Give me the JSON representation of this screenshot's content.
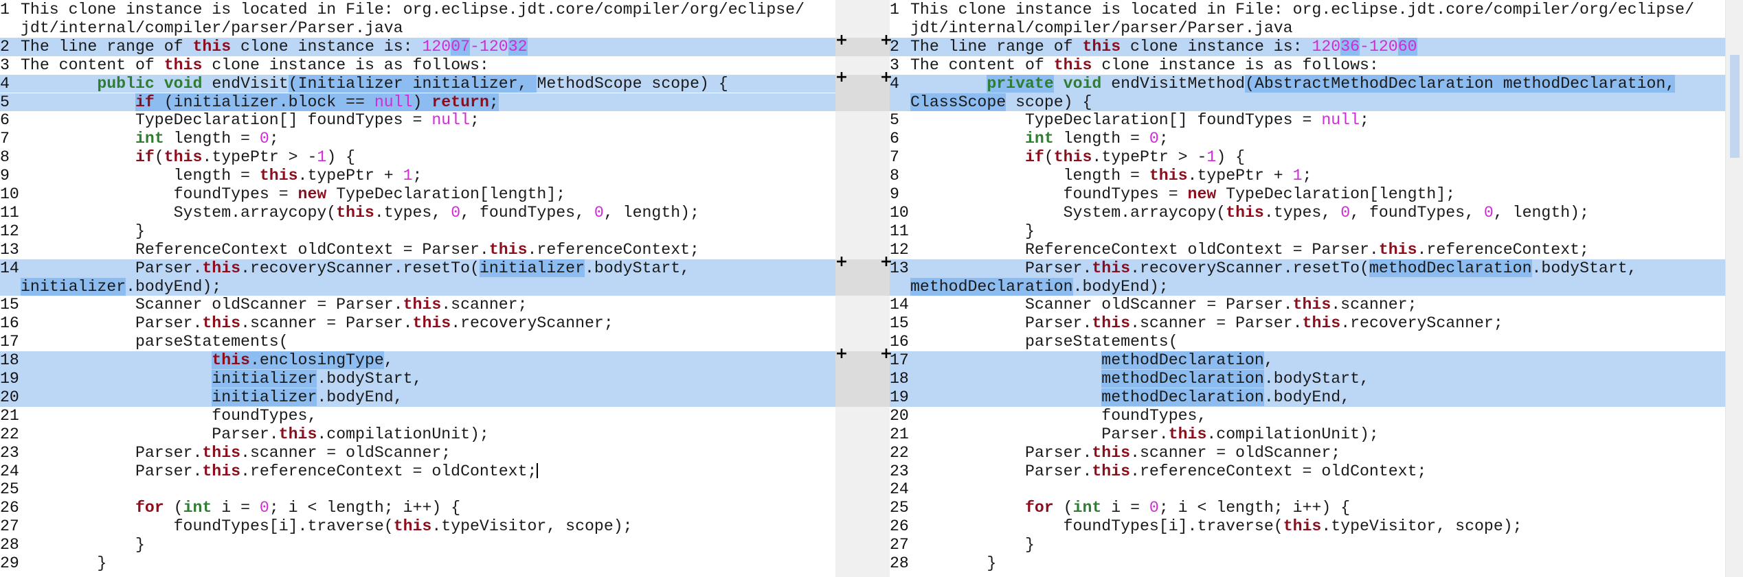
{
  "left": {
    "gutter_markers": [
      "+",
      "+",
      "+",
      "+"
    ],
    "lines": [
      {
        "n": "1",
        "segs": [
          [
            "This clone instance is located in File: org.eclipse.jdt.core/compiler/org/eclipse/",
            ""
          ]
        ],
        "segs2": [
          [
            "jdt/internal/compiler/parser/Parser.java",
            ""
          ]
        ]
      },
      {
        "n": "2",
        "segs": [
          [
            "The line range of ",
            ""
          ],
          [
            "this",
            "kw"
          ],
          [
            " clone instance is: ",
            ""
          ],
          [
            "120",
            "num"
          ],
          [
            "07",
            "num ch"
          ],
          [
            "-120",
            "num"
          ],
          [
            "32",
            "num ch"
          ]
        ]
      },
      {
        "n": "3",
        "segs": [
          [
            "The content of ",
            ""
          ],
          [
            "this",
            "kw"
          ],
          [
            " clone instance is as follows:",
            ""
          ]
        ]
      },
      {
        "n": "4",
        "segs": [
          [
            "        ",
            ""
          ],
          [
            "public",
            "kw2"
          ],
          [
            " ",
            ""
          ],
          [
            "void",
            "kw2"
          ],
          [
            " endVisit",
            ""
          ],
          [
            "(Initializer initializer, ",
            "ch"
          ],
          [
            "MethodScope scope) {",
            ""
          ]
        ]
      },
      {
        "n": "5",
        "segs": [
          [
            "            ",
            ""
          ],
          [
            "if",
            "kw ch"
          ],
          [
            " (initializer.block == ",
            "ch"
          ],
          [
            "null",
            "num ch"
          ],
          [
            ") ",
            "ch"
          ],
          [
            "return",
            "kw ch"
          ],
          [
            ";",
            "ch"
          ]
        ]
      },
      {
        "n": "6",
        "segs": [
          [
            "            TypeDeclaration[] foundTypes = ",
            ""
          ],
          [
            "null",
            "num"
          ],
          [
            ";",
            ""
          ]
        ]
      },
      {
        "n": "7",
        "segs": [
          [
            "            ",
            ""
          ],
          [
            "int",
            "kw2"
          ],
          [
            " length = ",
            ""
          ],
          [
            "0",
            "num"
          ],
          [
            ";",
            ""
          ]
        ]
      },
      {
        "n": "8",
        "segs": [
          [
            "            ",
            ""
          ],
          [
            "if",
            "kw"
          ],
          [
            "(",
            ""
          ],
          [
            "this",
            "kw"
          ],
          [
            ".typePtr > -",
            ""
          ],
          [
            "1",
            "num"
          ],
          [
            ") {",
            ""
          ]
        ]
      },
      {
        "n": "9",
        "segs": [
          [
            "                length = ",
            ""
          ],
          [
            "this",
            "kw"
          ],
          [
            ".typePtr + ",
            ""
          ],
          [
            "1",
            "num"
          ],
          [
            ";",
            ""
          ]
        ]
      },
      {
        "n": "10",
        "segs": [
          [
            "                foundTypes = ",
            ""
          ],
          [
            "new",
            "kw"
          ],
          [
            " TypeDeclaration[length];",
            ""
          ]
        ]
      },
      {
        "n": "11",
        "segs": [
          [
            "                System.arraycopy(",
            ""
          ],
          [
            "this",
            "kw"
          ],
          [
            ".types, ",
            ""
          ],
          [
            "0",
            "num"
          ],
          [
            ", foundTypes, ",
            ""
          ],
          [
            "0",
            "num"
          ],
          [
            ", length);",
            ""
          ]
        ]
      },
      {
        "n": "12",
        "segs": [
          [
            "            }",
            ""
          ]
        ]
      },
      {
        "n": "13",
        "segs": [
          [
            "            ReferenceContext oldContext = Parser.",
            ""
          ],
          [
            "this",
            "kw"
          ],
          [
            ".referenceContext;",
            ""
          ]
        ]
      },
      {
        "n": "14",
        "segs": [
          [
            "            Parser.",
            ""
          ],
          [
            "this",
            "kw"
          ],
          [
            ".recoveryScanner.resetTo(",
            ""
          ],
          [
            "initializer",
            "ch"
          ],
          [
            ".bodyStart,",
            ""
          ]
        ],
        "segs2": [
          [
            "initializer",
            "ch"
          ],
          [
            ".bodyEnd);",
            ""
          ]
        ]
      },
      {
        "n": "15",
        "segs": [
          [
            "            Scanner oldScanner = Parser.",
            ""
          ],
          [
            "this",
            "kw"
          ],
          [
            ".scanner;",
            ""
          ]
        ]
      },
      {
        "n": "16",
        "segs": [
          [
            "            Parser.",
            ""
          ],
          [
            "this",
            "kw"
          ],
          [
            ".scanner = Parser.",
            ""
          ],
          [
            "this",
            "kw"
          ],
          [
            ".recoveryScanner;",
            ""
          ]
        ]
      },
      {
        "n": "17",
        "segs": [
          [
            "            parseStatements(",
            ""
          ]
        ]
      },
      {
        "n": "18",
        "segs": [
          [
            "                    ",
            ""
          ],
          [
            "this",
            "kw ch"
          ],
          [
            ".enclosingType",
            "ch"
          ],
          [
            ",",
            ""
          ]
        ]
      },
      {
        "n": "19",
        "segs": [
          [
            "                    ",
            ""
          ],
          [
            "initializer",
            "ch"
          ],
          [
            ".bodyStart,",
            ""
          ]
        ]
      },
      {
        "n": "20",
        "segs": [
          [
            "                    ",
            ""
          ],
          [
            "initializer",
            "ch"
          ],
          [
            ".bodyEnd,",
            ""
          ]
        ]
      },
      {
        "n": "21",
        "segs": [
          [
            "                    foundTypes,",
            ""
          ]
        ]
      },
      {
        "n": "22",
        "segs": [
          [
            "                    Parser.",
            ""
          ],
          [
            "this",
            "kw"
          ],
          [
            ".compilationUnit);",
            ""
          ]
        ]
      },
      {
        "n": "23",
        "segs": [
          [
            "            Parser.",
            ""
          ],
          [
            "this",
            "kw"
          ],
          [
            ".scanner = oldScanner;",
            ""
          ]
        ]
      },
      {
        "n": "24",
        "segs": [
          [
            "            Parser.",
            ""
          ],
          [
            "this",
            "kw"
          ],
          [
            ".referenceContext = oldContext;",
            ""
          ]
        ],
        "caret": true
      },
      {
        "n": "25",
        "segs": [
          [
            "",
            ""
          ]
        ]
      },
      {
        "n": "26",
        "segs": [
          [
            "            ",
            ""
          ],
          [
            "for",
            "kw"
          ],
          [
            " (",
            ""
          ],
          [
            "int",
            "kw2"
          ],
          [
            " i = ",
            ""
          ],
          [
            "0",
            "num"
          ],
          [
            "; i < length; i++) {",
            ""
          ]
        ]
      },
      {
        "n": "27",
        "segs": [
          [
            "                foundTypes[i].traverse(",
            ""
          ],
          [
            "this",
            "kw"
          ],
          [
            ".typeVisitor, scope);",
            ""
          ]
        ]
      },
      {
        "n": "28",
        "segs": [
          [
            "            }",
            ""
          ]
        ]
      },
      {
        "n": "29",
        "segs": [
          [
            "        }",
            ""
          ]
        ]
      }
    ]
  },
  "right": {
    "gutter_markers": [
      "+",
      "+",
      "+",
      "+"
    ],
    "lines": [
      {
        "n": "1",
        "segs": [
          [
            "This clone instance is located in File: org.eclipse.jdt.core/compiler/org/eclipse/",
            ""
          ]
        ],
        "segs2": [
          [
            "jdt/internal/compiler/parser/Parser.java",
            ""
          ]
        ]
      },
      {
        "n": "2",
        "segs": [
          [
            "The line range of ",
            ""
          ],
          [
            "this",
            "kw"
          ],
          [
            " clone instance is: ",
            ""
          ],
          [
            "120",
            "num"
          ],
          [
            "36",
            "num ch"
          ],
          [
            "-120",
            "num"
          ],
          [
            "60",
            "num ch"
          ]
        ]
      },
      {
        "n": "3",
        "segs": [
          [
            "The content of ",
            ""
          ],
          [
            "this",
            "kw"
          ],
          [
            " clone instance is as follows:",
            ""
          ]
        ]
      },
      {
        "n": "4",
        "segs": [
          [
            "        ",
            ""
          ],
          [
            "private",
            "kw2 ch"
          ],
          [
            " ",
            ""
          ],
          [
            "void",
            "kw2"
          ],
          [
            " endVisitMethod",
            ""
          ],
          [
            "(AbstractMethodDeclaration methodDeclaration,",
            "ch"
          ]
        ],
        "segs2": [
          [
            "ClassScope",
            "ch"
          ],
          [
            " scope) {",
            ""
          ]
        ]
      },
      {
        "n": "5",
        "segs": [
          [
            "            TypeDeclaration[] foundTypes = ",
            ""
          ],
          [
            "null",
            "num"
          ],
          [
            ";",
            ""
          ]
        ]
      },
      {
        "n": "6",
        "segs": [
          [
            "            ",
            ""
          ],
          [
            "int",
            "kw2"
          ],
          [
            " length = ",
            ""
          ],
          [
            "0",
            "num"
          ],
          [
            ";",
            ""
          ]
        ]
      },
      {
        "n": "7",
        "segs": [
          [
            "            ",
            ""
          ],
          [
            "if",
            "kw"
          ],
          [
            "(",
            ""
          ],
          [
            "this",
            "kw"
          ],
          [
            ".typePtr > -",
            ""
          ],
          [
            "1",
            "num"
          ],
          [
            ") {",
            ""
          ]
        ]
      },
      {
        "n": "8",
        "segs": [
          [
            "                length = ",
            ""
          ],
          [
            "this",
            "kw"
          ],
          [
            ".typePtr + ",
            ""
          ],
          [
            "1",
            "num"
          ],
          [
            ";",
            ""
          ]
        ]
      },
      {
        "n": "9",
        "segs": [
          [
            "                foundTypes = ",
            ""
          ],
          [
            "new",
            "kw"
          ],
          [
            " TypeDeclaration[length];",
            ""
          ]
        ]
      },
      {
        "n": "10",
        "segs": [
          [
            "                System.arraycopy(",
            ""
          ],
          [
            "this",
            "kw"
          ],
          [
            ".types, ",
            ""
          ],
          [
            "0",
            "num"
          ],
          [
            ", foundTypes, ",
            ""
          ],
          [
            "0",
            "num"
          ],
          [
            ", length);",
            ""
          ]
        ]
      },
      {
        "n": "11",
        "segs": [
          [
            "            }",
            ""
          ]
        ]
      },
      {
        "n": "12",
        "segs": [
          [
            "            ReferenceContext oldContext = Parser.",
            ""
          ],
          [
            "this",
            "kw"
          ],
          [
            ".referenceContext;",
            ""
          ]
        ]
      },
      {
        "n": "13",
        "segs": [
          [
            "            Parser.",
            ""
          ],
          [
            "this",
            "kw"
          ],
          [
            ".recoveryScanner.resetTo(",
            ""
          ],
          [
            "methodDeclaration",
            "ch"
          ],
          [
            ".bodyStart,",
            ""
          ]
        ],
        "segs2": [
          [
            "methodDeclaration",
            "ch"
          ],
          [
            ".bodyEnd);",
            ""
          ]
        ]
      },
      {
        "n": "14",
        "segs": [
          [
            "            Scanner oldScanner = Parser.",
            ""
          ],
          [
            "this",
            "kw"
          ],
          [
            ".scanner;",
            ""
          ]
        ]
      },
      {
        "n": "15",
        "segs": [
          [
            "            Parser.",
            ""
          ],
          [
            "this",
            "kw"
          ],
          [
            ".scanner = Parser.",
            ""
          ],
          [
            "this",
            "kw"
          ],
          [
            ".recoveryScanner;",
            ""
          ]
        ]
      },
      {
        "n": "16",
        "segs": [
          [
            "            parseStatements(",
            ""
          ]
        ]
      },
      {
        "n": "17",
        "segs": [
          [
            "                    ",
            ""
          ],
          [
            "methodDeclaration",
            "ch"
          ],
          [
            ",",
            ""
          ]
        ]
      },
      {
        "n": "18",
        "segs": [
          [
            "                    ",
            ""
          ],
          [
            "methodDeclaration",
            "ch"
          ],
          [
            ".bodyStart,",
            ""
          ]
        ]
      },
      {
        "n": "19",
        "segs": [
          [
            "                    ",
            ""
          ],
          [
            "methodDeclaration",
            "ch"
          ],
          [
            ".bodyEnd,",
            ""
          ]
        ]
      },
      {
        "n": "20",
        "segs": [
          [
            "                    foundTypes,",
            ""
          ]
        ]
      },
      {
        "n": "21",
        "segs": [
          [
            "                    Parser.",
            ""
          ],
          [
            "this",
            "kw"
          ],
          [
            ".compilationUnit);",
            ""
          ]
        ]
      },
      {
        "n": "22",
        "segs": [
          [
            "            Parser.",
            ""
          ],
          [
            "this",
            "kw"
          ],
          [
            ".scanner = oldScanner;",
            ""
          ]
        ]
      },
      {
        "n": "23",
        "segs": [
          [
            "            Parser.",
            ""
          ],
          [
            "this",
            "kw"
          ],
          [
            ".referenceContext = oldContext;",
            ""
          ]
        ]
      },
      {
        "n": "24",
        "segs": [
          [
            "",
            ""
          ]
        ]
      },
      {
        "n": "25",
        "segs": [
          [
            "            ",
            ""
          ],
          [
            "for",
            "kw"
          ],
          [
            " (",
            ""
          ],
          [
            "int",
            "kw2"
          ],
          [
            " i = ",
            ""
          ],
          [
            "0",
            "num"
          ],
          [
            "; i < length; i++) {",
            ""
          ]
        ]
      },
      {
        "n": "26",
        "segs": [
          [
            "                foundTypes[i].traverse(",
            ""
          ],
          [
            "this",
            "kw"
          ],
          [
            ".typeVisitor, scope);",
            ""
          ]
        ]
      },
      {
        "n": "27",
        "segs": [
          [
            "            }",
            ""
          ]
        ]
      },
      {
        "n": "28",
        "segs": [
          [
            "        }",
            ""
          ]
        ]
      }
    ]
  }
}
